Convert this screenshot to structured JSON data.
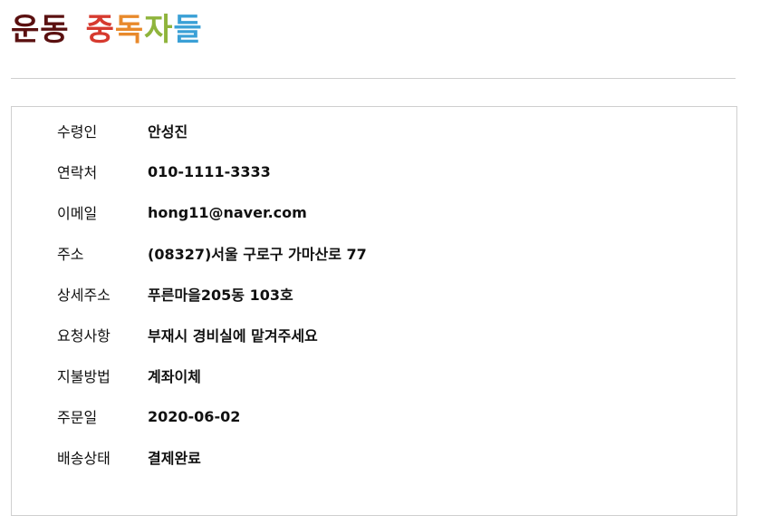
{
  "brand": {
    "parts": [
      {
        "text": "운동",
        "color": "#5a1010"
      },
      {
        "text": "중",
        "color": "#d63a2f"
      },
      {
        "text": "독",
        "color": "#e8892b"
      },
      {
        "text": "자",
        "color": "#8fb43c"
      },
      {
        "text": "들",
        "color": "#3aa0d6"
      }
    ]
  },
  "order": {
    "rows": [
      {
        "label": "수령인",
        "value": "안성진"
      },
      {
        "label": "연락처",
        "value": "010-1111-3333"
      },
      {
        "label": "이메일",
        "value": "hong11@naver.com"
      },
      {
        "label": "주소",
        "value": "(08327)서울 구로구 가마산로 77"
      },
      {
        "label": "상세주소",
        "value": "푸른마을205동 103호"
      },
      {
        "label": "요청사항",
        "value": "부재시 경비실에 맡겨주세요"
      },
      {
        "label": "지불방법",
        "value": "계좌이체"
      },
      {
        "label": "주문일",
        "value": "2020-06-02"
      },
      {
        "label": "배송상태",
        "value": "결제완료"
      }
    ]
  }
}
